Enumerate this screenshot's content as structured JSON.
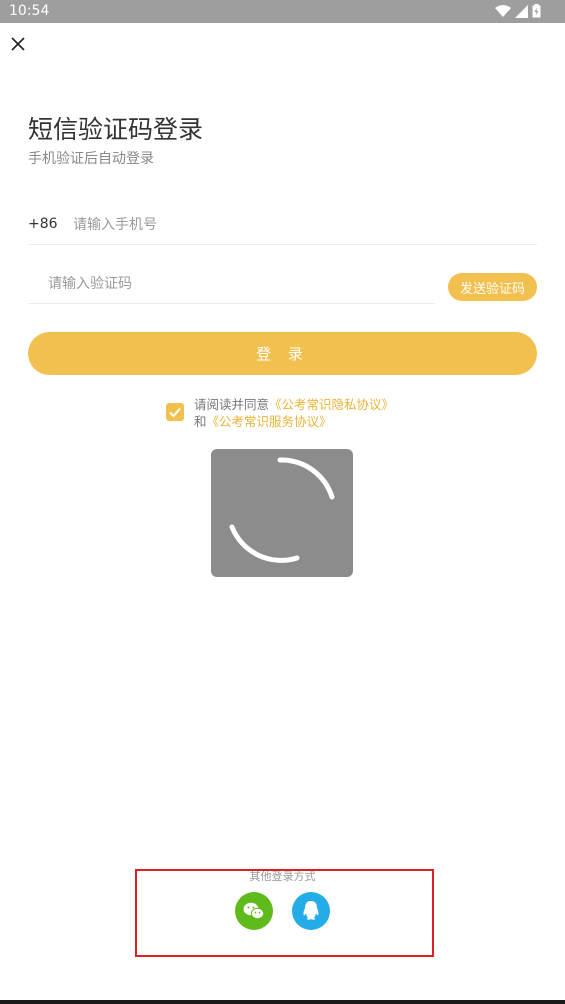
{
  "status_bar": {
    "time": "10:54"
  },
  "header": {
    "title": "短信验证码登录",
    "subtitle": "手机验证后自动登录"
  },
  "phone": {
    "country_code": "+86",
    "placeholder": "请输入手机号",
    "value": ""
  },
  "code": {
    "placeholder": "请输入验证码",
    "value": "",
    "send_label": "发送验证码"
  },
  "login": {
    "label": "登 录"
  },
  "agreement": {
    "checked": true,
    "prefix": "请阅读并同意",
    "privacy_link": "《公考常识隐私协议》",
    "conjunction": "和",
    "service_link": "《公考常识服务协议》"
  },
  "other_login": {
    "label": "其他登录方式"
  },
  "colors": {
    "accent": "#f2c04e",
    "link": "#e8b43a",
    "wechat": "#5fba1c",
    "qq": "#23ace7",
    "highlight": "#e02020"
  },
  "icons": {
    "close": "close-icon",
    "wechat": "wechat-icon",
    "qq": "qq-icon",
    "loading": "loading-spinner-icon"
  }
}
